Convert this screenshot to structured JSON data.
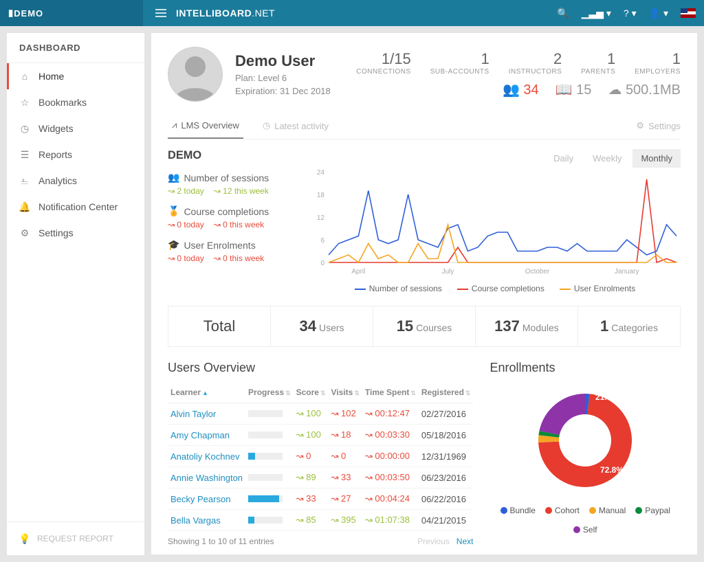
{
  "header": {
    "demo": "DEMO",
    "brand_bold": "INTELLIBOARD",
    "brand_thin": ".NET",
    "help": "?"
  },
  "sidebar": {
    "title": "DASHBOARD",
    "items": [
      {
        "icon": "home",
        "label": "Home"
      },
      {
        "icon": "star",
        "label": "Bookmarks"
      },
      {
        "icon": "clock",
        "label": "Widgets"
      },
      {
        "icon": "layers",
        "label": "Reports"
      },
      {
        "icon": "analytics",
        "label": "Analytics"
      },
      {
        "icon": "bell",
        "label": "Notification Center"
      },
      {
        "icon": "sliders",
        "label": "Settings"
      }
    ],
    "request_report": "REQUEST REPORT"
  },
  "user": {
    "name": "Demo User",
    "plan": "Plan: Level 6",
    "expiration": "Expiration: 31 Dec 2018"
  },
  "top_stats": [
    {
      "value": "1/15",
      "label": "CONNECTIONS"
    },
    {
      "value": "1",
      "label": "SUB-ACCOUNTS"
    },
    {
      "value": "2",
      "label": "INSTRUCTORS"
    },
    {
      "value": "1",
      "label": "PARENTS"
    },
    {
      "value": "1",
      "label": "EMPLOYERS"
    }
  ],
  "mini_stats": {
    "users": "34",
    "books": "15",
    "storage": "500.1MB"
  },
  "tabs": {
    "overview": "LMS Overview",
    "latest": "Latest activity",
    "settings": "Settings"
  },
  "demo": {
    "title": "DEMO",
    "metrics": {
      "sessions": {
        "title": "Number of sessions",
        "today": "2 today",
        "week": "12 this week"
      },
      "completions": {
        "title": "Course completions",
        "today": "0 today",
        "week": "0 this week"
      },
      "enrolments": {
        "title": "User Enrolments",
        "today": "0 today",
        "week": "0 this week"
      }
    },
    "period": {
      "daily": "Daily",
      "weekly": "Weekly",
      "monthly": "Monthly"
    }
  },
  "chart_data": {
    "type": "line",
    "x_ticks": [
      "April",
      "July",
      "October",
      "January"
    ],
    "ylim": [
      0,
      24
    ],
    "y_ticks": [
      0,
      6,
      12,
      18,
      24
    ],
    "series": [
      {
        "name": "Number of sessions",
        "color": "#2e5fd9",
        "values": [
          2,
          5,
          6,
          7,
          19,
          6,
          5,
          6,
          18,
          6,
          5,
          4,
          9,
          10,
          3,
          4,
          7,
          8,
          8,
          3,
          3,
          3,
          4,
          4,
          3,
          5,
          3,
          3,
          3,
          3,
          6,
          4,
          2,
          3,
          10,
          7
        ]
      },
      {
        "name": "Course completions",
        "color": "#e63b2e",
        "values": [
          0,
          0,
          0,
          0,
          0,
          0,
          0,
          0,
          0,
          0,
          0,
          0,
          0,
          4,
          0,
          0,
          0,
          0,
          0,
          0,
          0,
          0,
          0,
          0,
          0,
          0,
          0,
          0,
          0,
          0,
          0,
          0,
          22,
          0,
          1,
          0
        ]
      },
      {
        "name": "User Enrolments",
        "color": "#f5a623",
        "values": [
          0,
          1,
          2,
          0,
          5,
          1,
          2,
          0,
          0,
          5,
          1,
          1,
          10,
          0,
          0,
          0,
          0,
          0,
          0,
          0,
          0,
          0,
          0,
          0,
          0,
          0,
          0,
          0,
          0,
          0,
          0,
          0,
          0,
          2,
          0,
          0
        ]
      }
    ]
  },
  "totals": {
    "total": "Total",
    "cells": [
      {
        "value": "34",
        "label": "Users"
      },
      {
        "value": "15",
        "label": "Courses"
      },
      {
        "value": "137",
        "label": "Modules"
      },
      {
        "value": "1",
        "label": "Categories"
      }
    ]
  },
  "users_overview": {
    "title": "Users Overview",
    "headers": {
      "learner": "Learner",
      "progress": "Progress",
      "score": "Score",
      "visits": "Visits",
      "time": "Time Spent",
      "reg": "Registered"
    },
    "rows": [
      {
        "name": "Alvin Taylor",
        "progress": 0,
        "score": "100",
        "score_dir": "up",
        "visits": "102",
        "visits_dir": "down",
        "time": "00:12:47",
        "time_dir": "down",
        "reg": "02/27/2016"
      },
      {
        "name": "Amy Chapman",
        "progress": 0,
        "score": "100",
        "score_dir": "up",
        "visits": "18",
        "visits_dir": "down",
        "time": "00:03:30",
        "time_dir": "down",
        "reg": "05/18/2016"
      },
      {
        "name": "Anatoliy Kochnev",
        "progress": 20,
        "score": "0",
        "score_dir": "down",
        "visits": "0",
        "visits_dir": "down",
        "time": "00:00:00",
        "time_dir": "down",
        "reg": "12/31/1969"
      },
      {
        "name": "Annie Washington",
        "progress": 0,
        "score": "89",
        "score_dir": "up",
        "visits": "33",
        "visits_dir": "down",
        "time": "00:03:50",
        "time_dir": "down",
        "reg": "06/23/2016"
      },
      {
        "name": "Becky Pearson",
        "progress": 90,
        "score": "33",
        "score_dir": "down",
        "visits": "27",
        "visits_dir": "down",
        "time": "00:04:24",
        "time_dir": "down",
        "reg": "06/22/2016"
      },
      {
        "name": "Bella Vargas",
        "progress": 18,
        "score": "85",
        "score_dir": "up",
        "visits": "395",
        "visits_dir": "up",
        "time": "01:07:38",
        "time_dir": "up",
        "reg": "04/21/2015"
      }
    ],
    "showing": "Showing 1 to 10 of 11 entries",
    "prev": "Previous",
    "next": "Next"
  },
  "enrollments": {
    "title": "Enrollments",
    "donut": {
      "slices": [
        {
          "name": "Bundle",
          "color": "#2e5fd9",
          "pct": 1.5
        },
        {
          "name": "Cohort",
          "color": "#e63b2e",
          "pct": 72.8
        },
        {
          "name": "Manual",
          "color": "#f5a623",
          "pct": 2.5
        },
        {
          "name": "Paypal",
          "color": "#0a8a3a",
          "pct": 1.5
        },
        {
          "name": "Self",
          "color": "#8e33a8",
          "pct": 21.7
        }
      ],
      "labels": {
        "cohort": "72.8%",
        "self": "21.7%"
      }
    }
  }
}
